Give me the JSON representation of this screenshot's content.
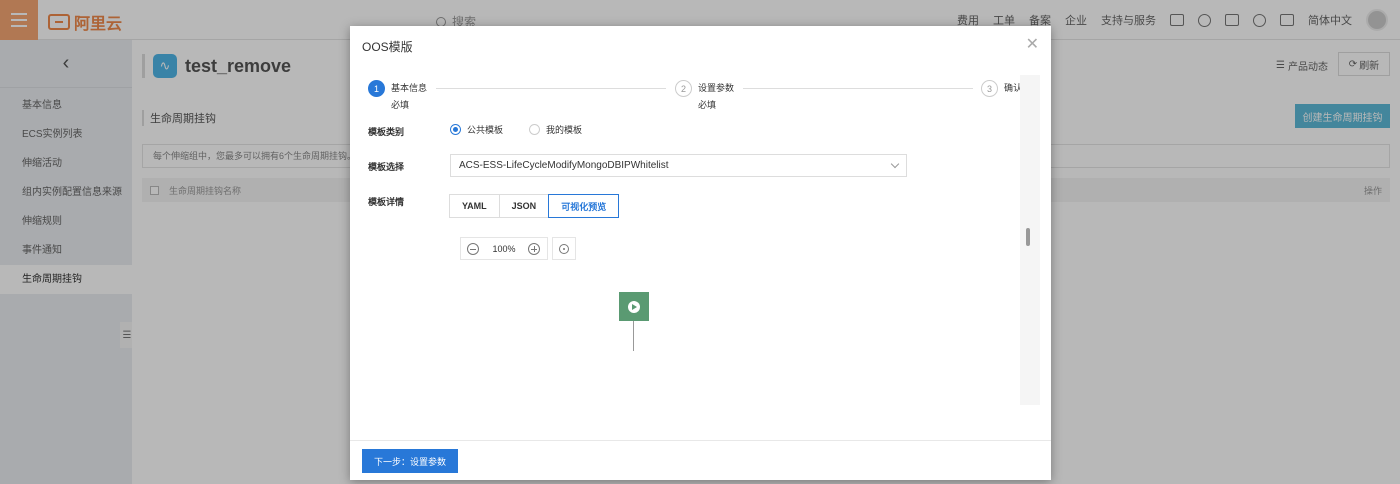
{
  "topbar": {
    "logo_text": "阿里云",
    "search_placeholder": "搜索",
    "nav": [
      "费用",
      "工单",
      "备案",
      "企业",
      "支持与服务"
    ],
    "language": "简体中文"
  },
  "sidebar": {
    "items": [
      {
        "label": "基本信息"
      },
      {
        "label": "ECS实例列表"
      },
      {
        "label": "伸缩活动"
      },
      {
        "label": "组内实例配置信息来源"
      },
      {
        "label": "伸缩规则"
      },
      {
        "label": "事件通知"
      },
      {
        "label": "生命周期挂钩",
        "active": true
      }
    ]
  },
  "main": {
    "page_title": "test_remove",
    "product_news": "产品动态",
    "refresh": "刷新",
    "section_title": "生命周期挂钩",
    "create_button": "创建生命周期挂钩",
    "notice": "每个伸缩组中，您最多可以拥有6个生命周期挂钩。",
    "table": {
      "col_name": "生命周期挂钩名称",
      "col_op": "操作"
    }
  },
  "dialog": {
    "title": "OOS模版",
    "steps": [
      {
        "num": "1",
        "title": "基本信息",
        "sub": "必填",
        "active": true
      },
      {
        "num": "2",
        "title": "设置参数",
        "sub": "必填",
        "active": false
      },
      {
        "num": "3",
        "title": "确认",
        "sub": "",
        "active": false
      }
    ],
    "template_type_label": "模板类别",
    "template_type_options": [
      {
        "label": "公共模板",
        "selected": true
      },
      {
        "label": "我的模板",
        "selected": false
      }
    ],
    "template_select_label": "模板选择",
    "template_select_value": "ACS-ESS-LifeCycleModifyMongoDBIPWhitelist",
    "template_detail_label": "模板详情",
    "tabs": [
      {
        "label": "YAML",
        "active": false
      },
      {
        "label": "JSON",
        "active": false
      },
      {
        "label": "可视化预览",
        "active": true
      }
    ],
    "zoom": "100%",
    "next_button": "下一步：设置参数"
  },
  "colors": {
    "primary": "#2878d8",
    "brand": "#f08a4b",
    "node": "#5a9a72"
  }
}
